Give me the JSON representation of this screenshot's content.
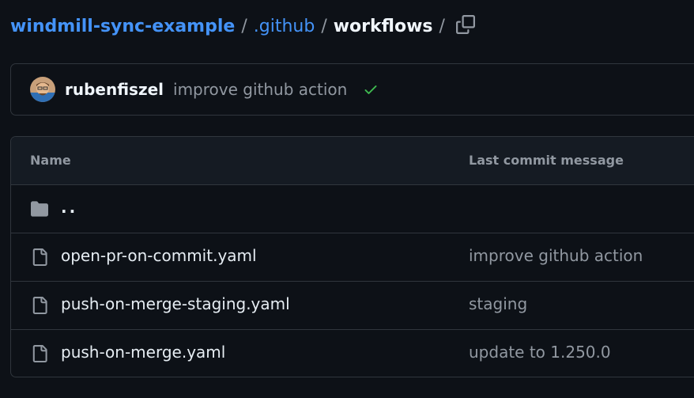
{
  "breadcrumb": {
    "repo": "windmill-sync-example",
    "separator": "/",
    "folder": ".github",
    "current": "workflows"
  },
  "icons": {
    "copy": "copy-icon",
    "check": "check-icon",
    "folder": "folder-icon",
    "file": "file-icon"
  },
  "colors": {
    "background": "#0d1117",
    "link": "#4493f8",
    "success": "#3fb950",
    "muted": "#9198a1",
    "border": "#30363d"
  },
  "latest_commit": {
    "author": "rubenfiszel",
    "message": "improve github action",
    "status": "success"
  },
  "table": {
    "headers": {
      "name": "Name",
      "last_commit": "Last commit message"
    },
    "parent": "..",
    "rows": [
      {
        "name": "open-pr-on-commit.yaml",
        "message": "improve github action"
      },
      {
        "name": "push-on-merge-staging.yaml",
        "message": "staging"
      },
      {
        "name": "push-on-merge.yaml",
        "message": "update to 1.250.0"
      }
    ]
  }
}
